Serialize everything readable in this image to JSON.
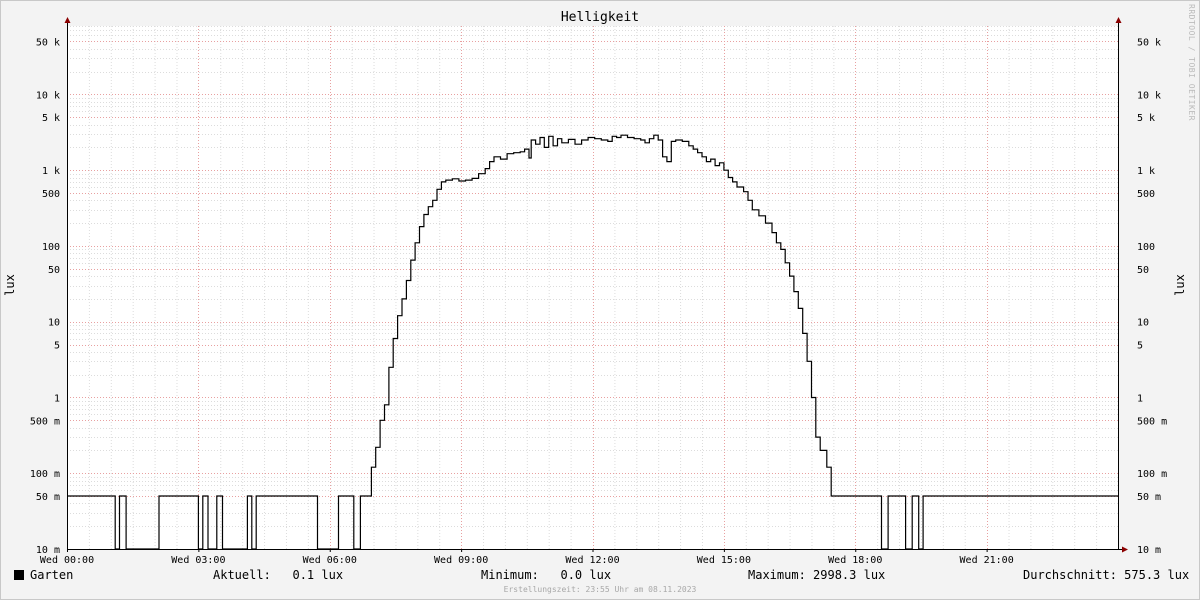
{
  "chart_data": {
    "type": "line",
    "title": "Helligkeit",
    "ylabel": "lux",
    "y_scale": "log",
    "ylim": [
      0.01,
      80000
    ],
    "xlim": [
      0,
      24
    ],
    "x_tick_labels": [
      {
        "x": 0,
        "label": "Wed 00:00"
      },
      {
        "x": 3,
        "label": "Wed 03:00"
      },
      {
        "x": 6,
        "label": "Wed 06:00"
      },
      {
        "x": 9,
        "label": "Wed 09:00"
      },
      {
        "x": 12,
        "label": "Wed 12:00"
      },
      {
        "x": 15,
        "label": "Wed 15:00"
      },
      {
        "x": 18,
        "label": "Wed 18:00"
      },
      {
        "x": 21,
        "label": "Wed 21:00"
      }
    ],
    "y_tick_labels": [
      {
        "y": 50000,
        "label": "50 k"
      },
      {
        "y": 10000,
        "label": "10 k"
      },
      {
        "y": 5000,
        "label": "5 k"
      },
      {
        "y": 1000,
        "label": "1 k"
      },
      {
        "y": 500,
        "label": "500"
      },
      {
        "y": 100,
        "label": "100"
      },
      {
        "y": 50,
        "label": "50"
      },
      {
        "y": 10,
        "label": "10"
      },
      {
        "y": 5,
        "label": "5"
      },
      {
        "y": 1,
        "label": "1"
      },
      {
        "y": 0.5,
        "label": "500 m"
      },
      {
        "y": 0.1,
        "label": "100 m"
      },
      {
        "y": 0.05,
        "label": "50 m"
      },
      {
        "y": 0.01,
        "label": "10 m"
      }
    ],
    "grid": true,
    "series": [
      {
        "name": "Garten",
        "color": "#000000",
        "points": [
          [
            0,
            0.05
          ],
          [
            1.05,
            0.05
          ],
          [
            1.1,
            0.01
          ],
          [
            1.15,
            0.01
          ],
          [
            1.2,
            0.05
          ],
          [
            1.3,
            0.05
          ],
          [
            1.35,
            0.01
          ],
          [
            2.05,
            0.01
          ],
          [
            2.1,
            0.05
          ],
          [
            2.95,
            0.05
          ],
          [
            3.0,
            0.01
          ],
          [
            3.05,
            0.01
          ],
          [
            3.1,
            0.05
          ],
          [
            3.2,
            0.05
          ],
          [
            3.22,
            0.01
          ],
          [
            3.4,
            0.01
          ],
          [
            3.42,
            0.05
          ],
          [
            3.5,
            0.05
          ],
          [
            3.55,
            0.01
          ],
          [
            4.1,
            0.01
          ],
          [
            4.12,
            0.05
          ],
          [
            4.2,
            0.05
          ],
          [
            4.22,
            0.01
          ],
          [
            4.3,
            0.01
          ],
          [
            4.32,
            0.05
          ],
          [
            5.7,
            0.05
          ],
          [
            5.72,
            0.01
          ],
          [
            6.15,
            0.01
          ],
          [
            6.2,
            0.05
          ],
          [
            6.5,
            0.05
          ],
          [
            6.55,
            0.01
          ],
          [
            6.65,
            0.01
          ],
          [
            6.7,
            0.05
          ],
          [
            6.9,
            0.05
          ],
          [
            6.95,
            0.12
          ],
          [
            7.05,
            0.22
          ],
          [
            7.15,
            0.5
          ],
          [
            7.25,
            0.8
          ],
          [
            7.35,
            2.5
          ],
          [
            7.45,
            6
          ],
          [
            7.55,
            12
          ],
          [
            7.65,
            20
          ],
          [
            7.75,
            35
          ],
          [
            7.85,
            65
          ],
          [
            7.95,
            110
          ],
          [
            8.05,
            180
          ],
          [
            8.15,
            260
          ],
          [
            8.25,
            330
          ],
          [
            8.35,
            400
          ],
          [
            8.45,
            560
          ],
          [
            8.55,
            700
          ],
          [
            8.65,
            740
          ],
          [
            8.8,
            770
          ],
          [
            8.95,
            720
          ],
          [
            9.1,
            740
          ],
          [
            9.25,
            780
          ],
          [
            9.4,
            900
          ],
          [
            9.55,
            1050
          ],
          [
            9.65,
            1300
          ],
          [
            9.75,
            1500
          ],
          [
            9.9,
            1400
          ],
          [
            10.05,
            1650
          ],
          [
            10.2,
            1700
          ],
          [
            10.35,
            1750
          ],
          [
            10.45,
            1900
          ],
          [
            10.55,
            1450
          ],
          [
            10.6,
            2500
          ],
          [
            10.7,
            2200
          ],
          [
            10.8,
            2700
          ],
          [
            10.9,
            2000
          ],
          [
            11.0,
            2800
          ],
          [
            11.1,
            2100
          ],
          [
            11.2,
            2600
          ],
          [
            11.3,
            2300
          ],
          [
            11.45,
            2550
          ],
          [
            11.6,
            2200
          ],
          [
            11.75,
            2500
          ],
          [
            11.9,
            2700
          ],
          [
            12.05,
            2600
          ],
          [
            12.2,
            2500
          ],
          [
            12.35,
            2400
          ],
          [
            12.45,
            2800
          ],
          [
            12.55,
            2700
          ],
          [
            12.65,
            2900
          ],
          [
            12.8,
            2700
          ],
          [
            12.95,
            2600
          ],
          [
            13.1,
            2500
          ],
          [
            13.2,
            2300
          ],
          [
            13.3,
            2600
          ],
          [
            13.4,
            2900
          ],
          [
            13.5,
            2500
          ],
          [
            13.6,
            1500
          ],
          [
            13.7,
            1300
          ],
          [
            13.8,
            2400
          ],
          [
            13.9,
            2500
          ],
          [
            14.05,
            2400
          ],
          [
            14.2,
            2100
          ],
          [
            14.3,
            1900
          ],
          [
            14.4,
            1700
          ],
          [
            14.5,
            1500
          ],
          [
            14.6,
            1300
          ],
          [
            14.7,
            1400
          ],
          [
            14.8,
            1150
          ],
          [
            14.9,
            1250
          ],
          [
            15.0,
            1000
          ],
          [
            15.1,
            800
          ],
          [
            15.2,
            700
          ],
          [
            15.3,
            600
          ],
          [
            15.45,
            520
          ],
          [
            15.55,
            400
          ],
          [
            15.65,
            300
          ],
          [
            15.8,
            250
          ],
          [
            15.95,
            200
          ],
          [
            16.1,
            150
          ],
          [
            16.2,
            110
          ],
          [
            16.3,
            90
          ],
          [
            16.4,
            60
          ],
          [
            16.5,
            40
          ],
          [
            16.6,
            25
          ],
          [
            16.7,
            15
          ],
          [
            16.8,
            7
          ],
          [
            16.9,
            3
          ],
          [
            17.0,
            1
          ],
          [
            17.1,
            0.3
          ],
          [
            17.2,
            0.2
          ],
          [
            17.35,
            0.12
          ],
          [
            17.45,
            0.05
          ],
          [
            18.55,
            0.05
          ],
          [
            18.6,
            0.01
          ],
          [
            18.7,
            0.01
          ],
          [
            18.75,
            0.05
          ],
          [
            19.1,
            0.05
          ],
          [
            19.15,
            0.01
          ],
          [
            19.25,
            0.01
          ],
          [
            19.3,
            0.05
          ],
          [
            19.4,
            0.05
          ],
          [
            19.45,
            0.01
          ],
          [
            19.5,
            0.01
          ],
          [
            19.55,
            0.05
          ],
          [
            24,
            0.05
          ]
        ]
      }
    ]
  },
  "legend": {
    "series_name": "Garten",
    "current": "Aktuell:   0.1 lux",
    "minimum": "Minimum:   0.0 lux",
    "maximum": "Maximum: 2998.3 lux",
    "average": "Durchschnitt: 575.3 lux"
  },
  "watermark": "RRDTOOL / TOBI OETIKER",
  "footer": "Erstellungszeit: 23:55 Uhr am 08.11.2023"
}
